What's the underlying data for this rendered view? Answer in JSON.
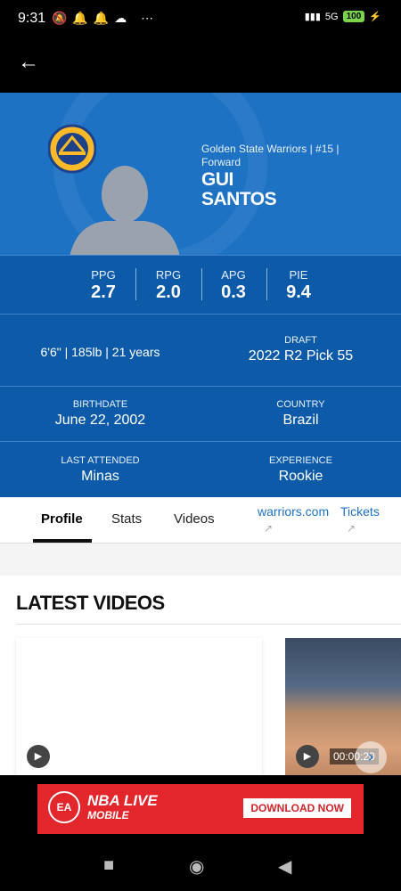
{
  "status_bar": {
    "time": "9:31",
    "network": "5G",
    "battery": "100"
  },
  "header": {
    "back_icon": "arrow-left-icon"
  },
  "player": {
    "team_line": "Golden State Warriors | #15 |",
    "position": "Forward",
    "first_name": "GUI",
    "last_name": "SANTOS",
    "logo_text": "GOLDEN STATE WARRIORS"
  },
  "stats": [
    {
      "label": "PPG",
      "value": "2.7"
    },
    {
      "label": "RPG",
      "value": "2.0"
    },
    {
      "label": "APG",
      "value": "0.3"
    },
    {
      "label": "PIE",
      "value": "9.4"
    }
  ],
  "info": {
    "physical": "6'6\" | 185lb | 21 years",
    "draft_label": "DRAFT",
    "draft_value": "2022 R2 Pick 55",
    "birthdate_label": "BIRTHDATE",
    "birthdate_value": "June 22, 2002",
    "country_label": "COUNTRY",
    "country_value": "Brazil",
    "last_attended_label": "LAST ATTENDED",
    "last_attended_value": "Minas",
    "experience_label": "EXPERIENCE",
    "experience_value": "Rookie"
  },
  "tabs": {
    "profile": "Profile",
    "stats": "Stats",
    "videos": "Videos",
    "warriors_link": "warriors.com",
    "tickets_link": "Tickets"
  },
  "videos": {
    "section_title": "LATEST VIDEOS",
    "duration": "00:00:20"
  },
  "ad": {
    "brand": "EA",
    "game": "NBA LIVE",
    "platform": "MOBILE",
    "cta": "DOWNLOAD NOW",
    "accent": "#e3262b"
  },
  "colors": {
    "team_blue": "#1d72c4",
    "panel_blue": "#0d5ba8"
  }
}
